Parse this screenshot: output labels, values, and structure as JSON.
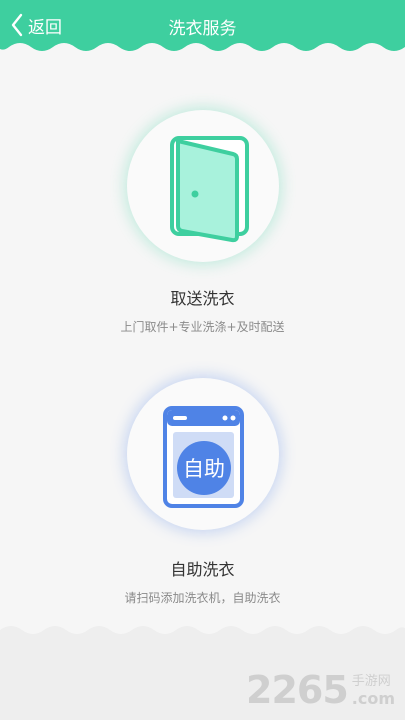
{
  "header": {
    "back_label": "返回",
    "title": "洗衣服务"
  },
  "options": [
    {
      "title": "取送洗衣",
      "description": "上门取件+专业洗涤+及时配送",
      "icon": "door-icon",
      "accent": "#3ecf9f"
    },
    {
      "title": "自助洗衣",
      "description": "请扫码添加洗衣机，自助洗衣",
      "icon": "washing-machine-icon",
      "icon_text": "自助",
      "accent": "#4f83e6"
    }
  ],
  "watermark": {
    "number": "2265",
    "cn": "手游网",
    "domain": ".com"
  },
  "colors": {
    "header": "#3ecf9f",
    "background": "#f6f6f6",
    "footer": "#eeeeee"
  }
}
